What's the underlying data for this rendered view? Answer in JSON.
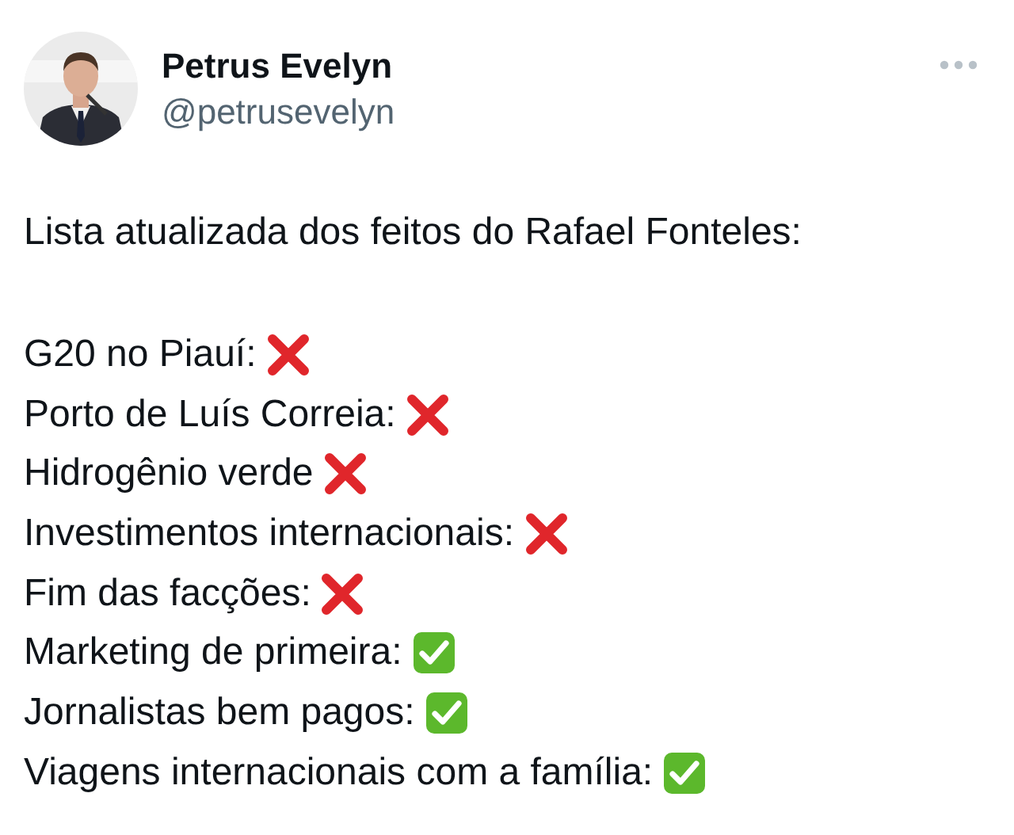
{
  "author": {
    "name": "Petrus Evelyn",
    "handle": "@petrusevelyn"
  },
  "post": {
    "intro": "Lista atualizada dos feitos do Rafael Fonteles:",
    "items": [
      {
        "text": "G20 no Piauí:",
        "checked": false
      },
      {
        "text": "Porto de Luís Correia:",
        "checked": false
      },
      {
        "text": "Hidrogênio verde",
        "checked": false
      },
      {
        "text": "Investimentos internacionais:",
        "checked": false
      },
      {
        "text": "Fim das facções:",
        "checked": false
      },
      {
        "text": "Marketing de primeira:",
        "checked": true
      },
      {
        "text": "Jornalistas bem pagos:",
        "checked": true
      },
      {
        "text": "Viagens internacionais com a família:",
        "checked": true
      }
    ]
  }
}
